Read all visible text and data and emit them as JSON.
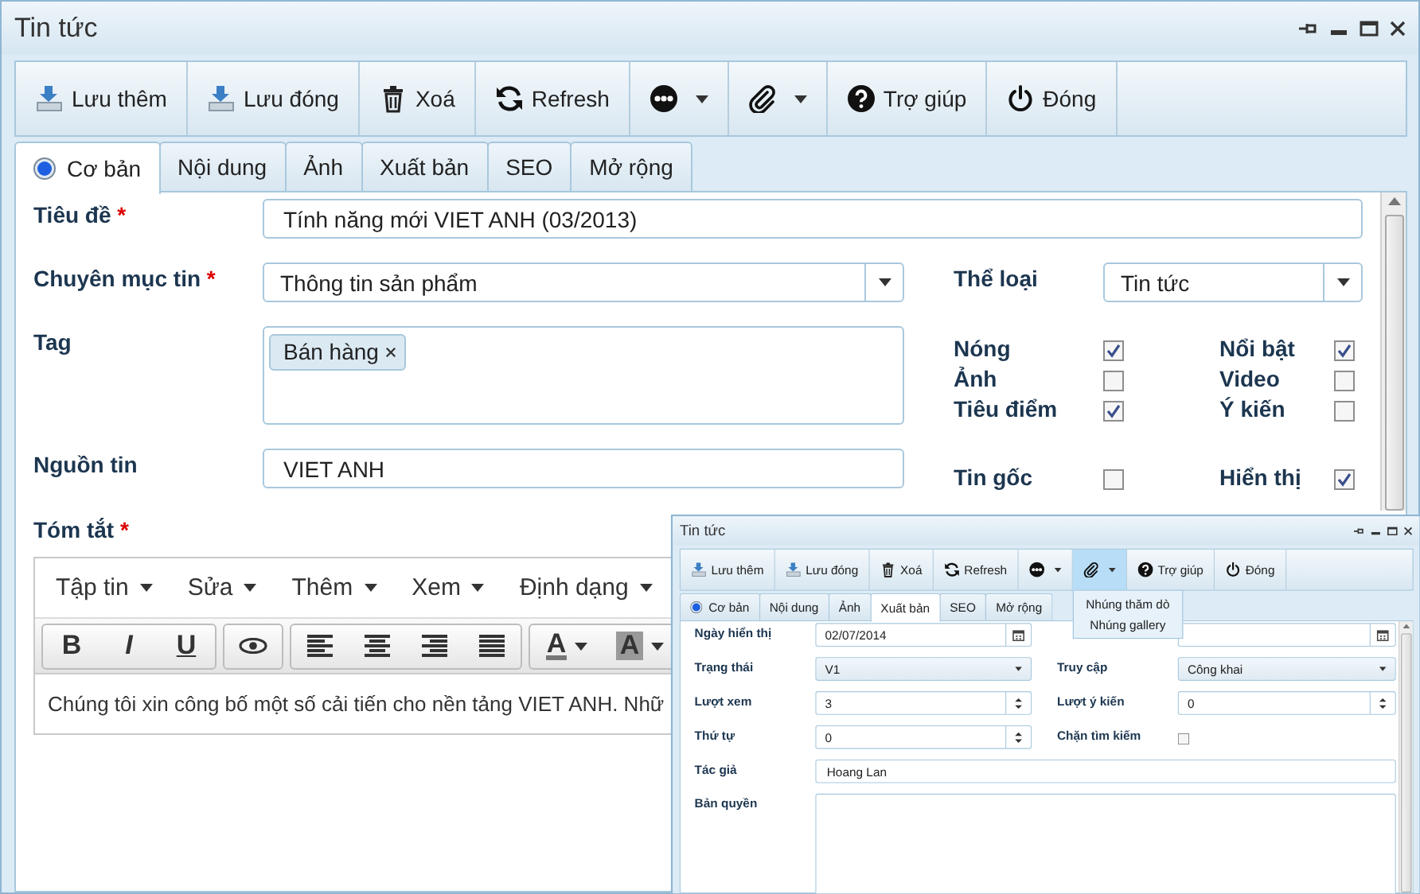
{
  "window": {
    "title": "Tin tức"
  },
  "toolbar": [
    {
      "kind": "save",
      "label": "Lưu thêm"
    },
    {
      "kind": "save",
      "label": "Lưu đóng"
    },
    {
      "kind": "delete",
      "label": "Xoá"
    },
    {
      "kind": "refresh",
      "label": "Refresh"
    },
    {
      "kind": "more"
    },
    {
      "kind": "attach"
    },
    {
      "kind": "help",
      "label": "Trợ giúp"
    },
    {
      "kind": "close",
      "label": "Đóng"
    }
  ],
  "tabs": [
    {
      "label": "Cơ bản",
      "kind": "radio",
      "selected": true
    },
    {
      "label": "Nội dung",
      "kind": "plain",
      "selected": false
    },
    {
      "label": "Ảnh",
      "kind": "plain",
      "selected": false
    },
    {
      "label": "Xuất bản",
      "kind": "plain",
      "selected": false
    },
    {
      "label": "SEO",
      "kind": "plain",
      "selected": false
    },
    {
      "label": "Mở rộng",
      "kind": "plain",
      "selected": false
    }
  ],
  "form": {
    "title": {
      "label": "Tiêu đề",
      "mark": "*",
      "value": "Tính năng mới VIET ANH (03/2013)"
    },
    "category": {
      "label": "Chuyên mục tin",
      "mark": "*",
      "value": "Thông tin sản phẩm"
    },
    "type": {
      "label": "Thể loại",
      "value": "Tin tức"
    },
    "tag": {
      "label": "Tag",
      "chips": [
        "Bán hàng"
      ]
    },
    "source": {
      "label": "Nguồn tin",
      "value": "VIET ANH"
    },
    "flag_groups": [
      [
        {
          "label": "Nóng",
          "checked": true
        },
        {
          "label": "Nổi bật",
          "checked": true
        },
        {
          "label": "Ảnh",
          "checked": false
        },
        {
          "label": "Video",
          "checked": false
        },
        {
          "label": "Tiêu điểm",
          "checked": true
        },
        {
          "label": "Ý kiến",
          "checked": false
        }
      ],
      [
        {
          "label": "Tin gốc",
          "checked": false
        },
        {
          "label": "Hiển thị",
          "checked": true
        }
      ]
    ],
    "summary": {
      "label": "Tóm tắt",
      "mark": "*"
    }
  },
  "editor": {
    "menu": [
      "Tập tin",
      "Sửa",
      "Thêm",
      "Xem",
      "Định dạng"
    ],
    "toolbar_groups": [
      [
        {
          "kind": "bold",
          "label": "B"
        },
        {
          "kind": "italic",
          "label": "I"
        },
        {
          "kind": "underline",
          "label": "U"
        }
      ],
      [
        {
          "kind": "preview"
        }
      ],
      [
        {
          "kind": "align-left"
        },
        {
          "kind": "align-center"
        },
        {
          "kind": "align-right"
        },
        {
          "kind": "justify"
        }
      ],
      [
        {
          "kind": "text-color",
          "label": "A"
        },
        {
          "kind": "background-color",
          "label": "A"
        }
      ]
    ],
    "text": "Chúng tôi xin công bố một số cải tiến cho nền tảng VIET ANH. Nhữ"
  },
  "inset_window": {
    "title": "Tin tức",
    "toolbar": [
      {
        "kind": "save",
        "label": "Lưu thêm",
        "expanded": false
      },
      {
        "kind": "save",
        "label": "Lưu đóng",
        "expanded": false
      },
      {
        "kind": "delete",
        "label": "Xoá",
        "expanded": false
      },
      {
        "kind": "refresh",
        "label": "Refresh",
        "expanded": false
      },
      {
        "kind": "more",
        "expanded": false
      },
      {
        "kind": "attach",
        "expanded": true,
        "menu": [
          "Nhúng thăm dò",
          "Nhúng gallery"
        ]
      },
      {
        "kind": "help",
        "label": "Trợ giúp",
        "expanded": false
      },
      {
        "kind": "close",
        "label": "Đóng",
        "expanded": false
      }
    ],
    "tabs": [
      {
        "label": "Cơ bản",
        "kind": "radio",
        "selected": false
      },
      {
        "label": "Nội dung",
        "kind": "plain",
        "selected": false
      },
      {
        "label": "Ảnh",
        "kind": "plain",
        "selected": false
      },
      {
        "label": "Xuất bản",
        "kind": "plain",
        "selected": true
      },
      {
        "label": "SEO",
        "kind": "plain",
        "selected": false
      },
      {
        "label": "Mở rộng",
        "kind": "plain",
        "selected": false
      }
    ],
    "fields": [
      {
        "kind": "date",
        "label": "Ngày hiển thị",
        "value": "02/07/2014"
      },
      {
        "kind": "date"
      },
      {
        "kind": "select",
        "label": "Trạng thái",
        "value": "V1"
      },
      {
        "kind": "select",
        "label": "Truy cập",
        "value": "Công khai"
      },
      {
        "kind": "number",
        "label": "Lượt xem",
        "value": "3"
      },
      {
        "kind": "number",
        "label": "Lượt ý kiến",
        "value": "0"
      },
      {
        "kind": "number",
        "label": "Thứ tự",
        "value": "0"
      },
      {
        "kind": "checkbox",
        "label": "Chặn tìm kiếm",
        "checked": false
      },
      {
        "kind": "text",
        "label": "Tác giả",
        "value": "Hoang Lan"
      },
      {
        "kind": "textarea",
        "label": "Bản quyền"
      }
    ]
  }
}
